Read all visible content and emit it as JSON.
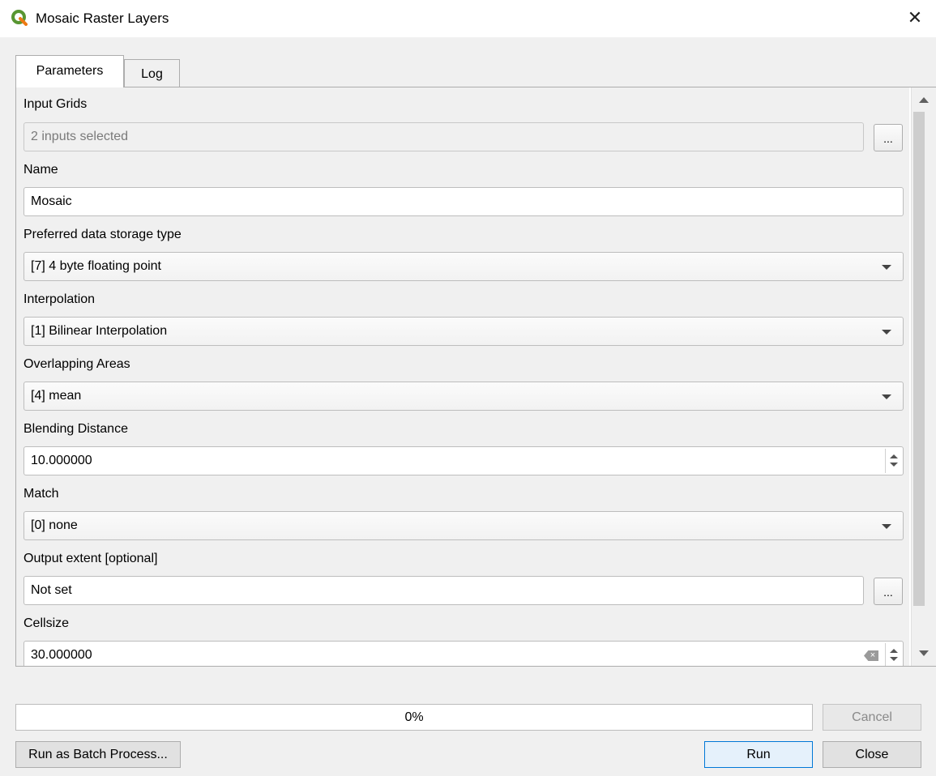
{
  "window": {
    "title": "Mosaic Raster Layers",
    "close_glyph": "✕"
  },
  "tabs": [
    {
      "label": "Parameters"
    },
    {
      "label": "Log"
    }
  ],
  "params": {
    "input_grids_label": "Input Grids",
    "input_grids_value": "2 inputs selected",
    "dots_label": "...",
    "name_label": "Name",
    "name_value": "Mosaic",
    "storage_label": "Preferred data storage type",
    "storage_value": "[7] 4 byte floating point",
    "interp_label": "Interpolation",
    "interp_value": "[1] Bilinear Interpolation",
    "overlap_label": "Overlapping Areas",
    "overlap_value": "[4] mean",
    "blend_label": "Blending Distance",
    "blend_value": "10.000000",
    "match_label": "Match",
    "match_value": "[0] none",
    "extent_label": "Output extent [optional]",
    "extent_value": "Not set",
    "extent_dots_label": "...",
    "cellsize_label": "Cellsize",
    "cellsize_value": "30.000000"
  },
  "footer": {
    "progress_text": "0%",
    "progress_value": 0,
    "cancel_label": "Cancel",
    "batch_label": "Run as Batch Process...",
    "run_label": "Run",
    "close_label": "Close"
  },
  "icons": {
    "app": "qgis-logo-icon",
    "close": "close-icon",
    "clear": "clear-input-icon"
  },
  "colors": {
    "qgis_green": "#589632",
    "qgis_yellow": "#ee7913",
    "default_button_border": "#0078d7"
  }
}
